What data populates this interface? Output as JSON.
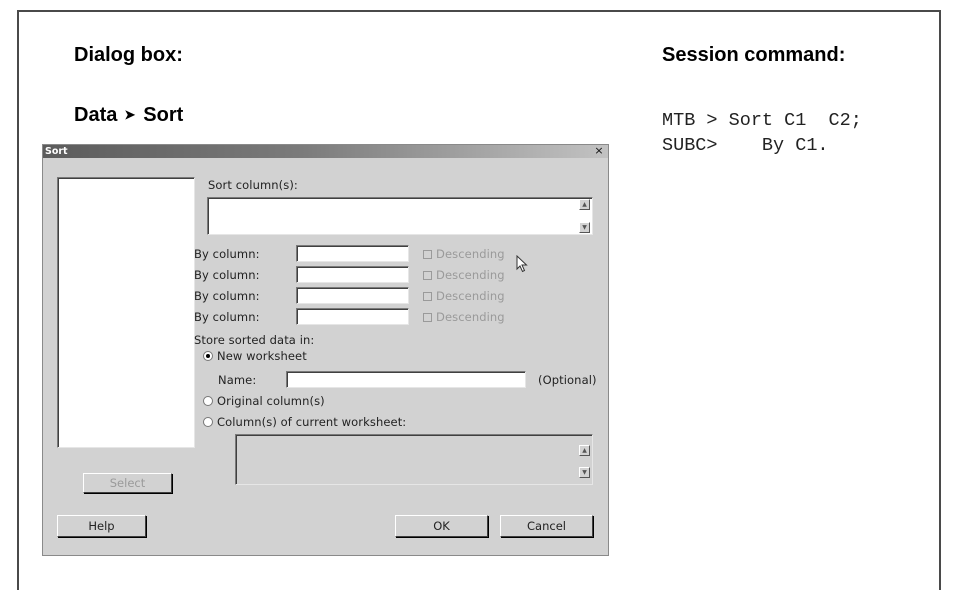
{
  "left_heading": "Dialog box:",
  "menu_path": {
    "menu": "Data",
    "item": "Sort"
  },
  "right_heading": "Session  command:",
  "session_lines": [
    "MTB > Sort C1  C2;",
    "SUBC>    By C1."
  ],
  "dialog": {
    "title": "Sort",
    "close_glyph": "×",
    "sort_columns_label": "Sort column(s):",
    "by_rows": [
      {
        "label": "By column:",
        "value": "",
        "descending_label": "Descending"
      },
      {
        "label": "By column:",
        "value": "",
        "descending_label": "Descending"
      },
      {
        "label": "By column:",
        "value": "",
        "descending_label": "Descending"
      },
      {
        "label": "By column:",
        "value": "",
        "descending_label": "Descending"
      }
    ],
    "store_label": "Store sorted data in:",
    "options": {
      "new_worksheet": "New worksheet",
      "name_label": "Name:",
      "name_value": "",
      "optional": "(Optional)",
      "original_columns": "Original column(s)",
      "current_worksheet": "Column(s) of current worksheet:"
    },
    "selected_option": "new_worksheet",
    "buttons": {
      "select": "Select",
      "help": "Help",
      "ok": "OK",
      "cancel": "Cancel"
    }
  }
}
